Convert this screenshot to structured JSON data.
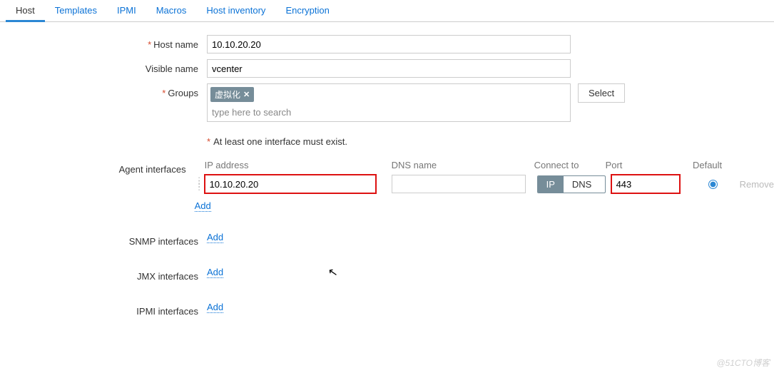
{
  "tabs": [
    {
      "label": "Host",
      "active": true
    },
    {
      "label": "Templates"
    },
    {
      "label": "IPMI"
    },
    {
      "label": "Macros"
    },
    {
      "label": "Host inventory"
    },
    {
      "label": "Encryption"
    }
  ],
  "labels": {
    "host_name": "Host name",
    "visible_name": "Visible name",
    "groups": "Groups",
    "agent_if": "Agent interfaces",
    "snmp_if": "SNMP interfaces",
    "jmx_if": "JMX interfaces",
    "ipmi_if": "IPMI interfaces"
  },
  "fields": {
    "host_name": "10.10.20.20",
    "visible_name": "vcenter",
    "group_chip": "虚拟化",
    "group_search_placeholder": "type here to search",
    "select_btn": "Select",
    "hint": "At least one interface must exist."
  },
  "iface_head": {
    "ip": "IP address",
    "dns": "DNS name",
    "connect": "Connect to",
    "port": "Port",
    "default": "Default"
  },
  "agent_row": {
    "ip": "10.10.20.20",
    "dns": "",
    "conn_ip": "IP",
    "conn_dns": "DNS",
    "port": "443",
    "remove": "Remove"
  },
  "links": {
    "add": "Add"
  },
  "watermark": "@51CTO博客"
}
